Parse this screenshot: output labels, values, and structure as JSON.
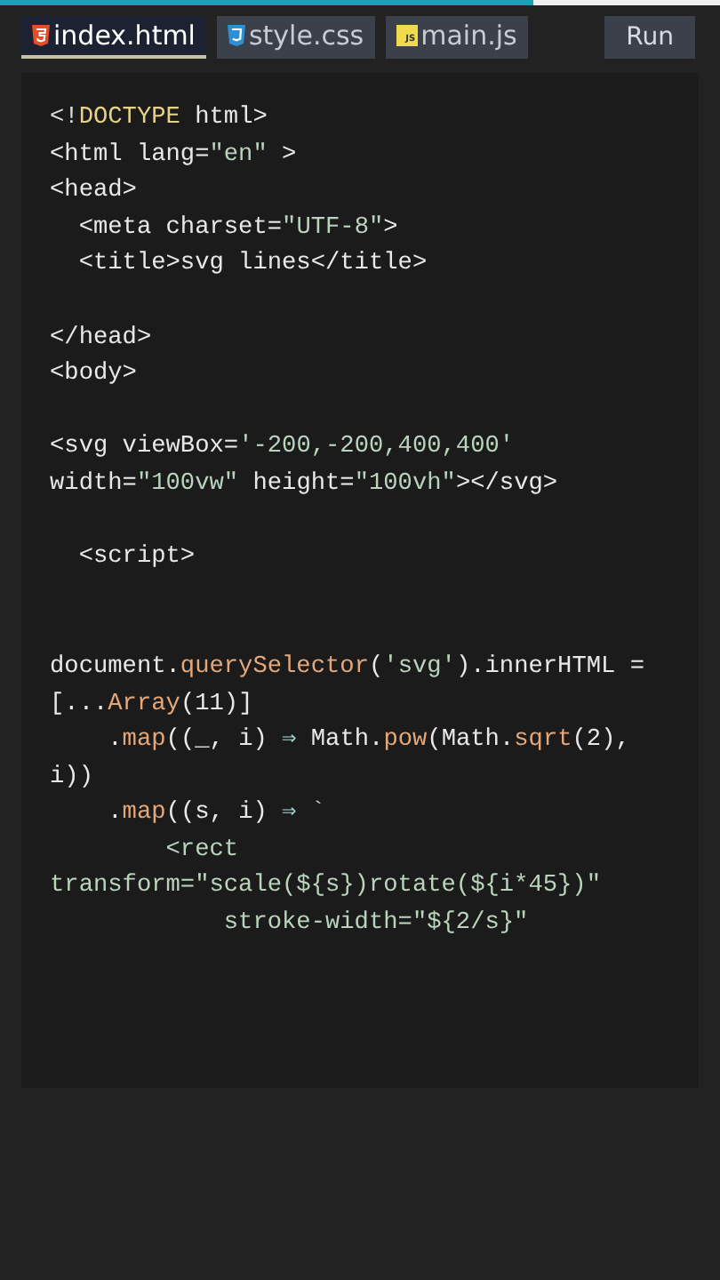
{
  "progress": {
    "level": 0.74
  },
  "tabs": [
    {
      "label": "index.html",
      "kind": "html",
      "selected": true
    },
    {
      "label": "style.css",
      "kind": "css",
      "selected": false
    },
    {
      "label": "main.js",
      "kind": "js",
      "icon_label": "JS",
      "selected": false
    }
  ],
  "run_button": "Run",
  "code_lines": [
    {
      "kind": "code",
      "segments": [
        {
          "text": "<!",
          "kind": "punct"
        },
        {
          "text": "DOCTYPE",
          "kind": "keyword"
        },
        {
          "text": " html>",
          "kind": "plain"
        }
      ]
    },
    {
      "kind": "code",
      "segments": [
        {
          "text": "<html lang=",
          "kind": "plain"
        },
        {
          "text": "\"en\"",
          "kind": "string"
        },
        {
          "text": " >",
          "kind": "plain"
        }
      ]
    },
    {
      "kind": "code",
      "segments": [
        {
          "text": "<head>",
          "kind": "plain"
        }
      ]
    },
    {
      "kind": "code",
      "segments": [
        {
          "text": "  <meta charset=",
          "kind": "plain"
        },
        {
          "text": "\"UTF-8\"",
          "kind": "string"
        },
        {
          "text": ">",
          "kind": "plain"
        }
      ]
    },
    {
      "kind": "code",
      "segments": [
        {
          "text": "  <title>svg lines</title>",
          "kind": "plain"
        }
      ]
    },
    {
      "kind": "blank"
    },
    {
      "kind": "code",
      "segments": [
        {
          "text": "</head>",
          "kind": "plain"
        }
      ]
    },
    {
      "kind": "code",
      "segments": [
        {
          "text": "<body>",
          "kind": "plain"
        }
      ]
    },
    {
      "kind": "blank"
    },
    {
      "kind": "code",
      "segments": [
        {
          "text": "<svg viewBox=",
          "kind": "plain"
        },
        {
          "text": "'-200,-200,400,400'",
          "kind": "string"
        }
      ]
    },
    {
      "kind": "code",
      "segments": [
        {
          "text": "width=",
          "kind": "plain"
        },
        {
          "text": "\"100vw\"",
          "kind": "string"
        },
        {
          "text": " height=",
          "kind": "plain"
        },
        {
          "text": "\"100vh\"",
          "kind": "string"
        },
        {
          "text": "></svg>",
          "kind": "plain"
        }
      ]
    },
    {
      "kind": "blank"
    },
    {
      "kind": "code",
      "segments": [
        {
          "text": "  <script>",
          "kind": "plain"
        }
      ]
    },
    {
      "kind": "blank"
    },
    {
      "kind": "blank"
    },
    {
      "kind": "code",
      "segments": [
        {
          "text": "document.",
          "kind": "plain"
        },
        {
          "text": "querySelector",
          "kind": "fn"
        },
        {
          "text": "(",
          "kind": "plain"
        },
        {
          "text": "'svg'",
          "kind": "string"
        },
        {
          "text": ").innerHTML =",
          "kind": "plain"
        }
      ]
    },
    {
      "kind": "code",
      "segments": [
        {
          "text": "[...",
          "kind": "plain"
        },
        {
          "text": "Array",
          "kind": "fn"
        },
        {
          "text": "(11)]",
          "kind": "plain"
        }
      ]
    },
    {
      "kind": "code",
      "segments": [
        {
          "text": "    .",
          "kind": "plain"
        },
        {
          "text": "map",
          "kind": "fn"
        },
        {
          "text": "((_, i) ",
          "kind": "plain"
        },
        {
          "text": "⇒",
          "kind": "arrow"
        },
        {
          "text": " Math.",
          "kind": "plain"
        },
        {
          "text": "pow",
          "kind": "fn"
        },
        {
          "text": "(Math.",
          "kind": "plain"
        },
        {
          "text": "sqrt",
          "kind": "fn"
        },
        {
          "text": "(2),",
          "kind": "plain"
        }
      ]
    },
    {
      "kind": "code",
      "segments": [
        {
          "text": "i))",
          "kind": "plain"
        }
      ]
    },
    {
      "kind": "code",
      "segments": [
        {
          "text": "    .",
          "kind": "plain"
        },
        {
          "text": "map",
          "kind": "fn"
        },
        {
          "text": "((s, i) ",
          "kind": "plain"
        },
        {
          "text": "⇒",
          "kind": "arrow"
        },
        {
          "text": " `",
          "kind": "string"
        }
      ]
    },
    {
      "kind": "code",
      "segments": [
        {
          "text": "        <rect",
          "kind": "string"
        }
      ]
    },
    {
      "kind": "code",
      "segments": [
        {
          "text": "transform=\"scale(${s})rotate(${i*45})\"",
          "kind": "string"
        }
      ]
    },
    {
      "kind": "code",
      "segments": [
        {
          "text": "            stroke-width=\"${2/s}\"",
          "kind": "string"
        }
      ]
    }
  ]
}
